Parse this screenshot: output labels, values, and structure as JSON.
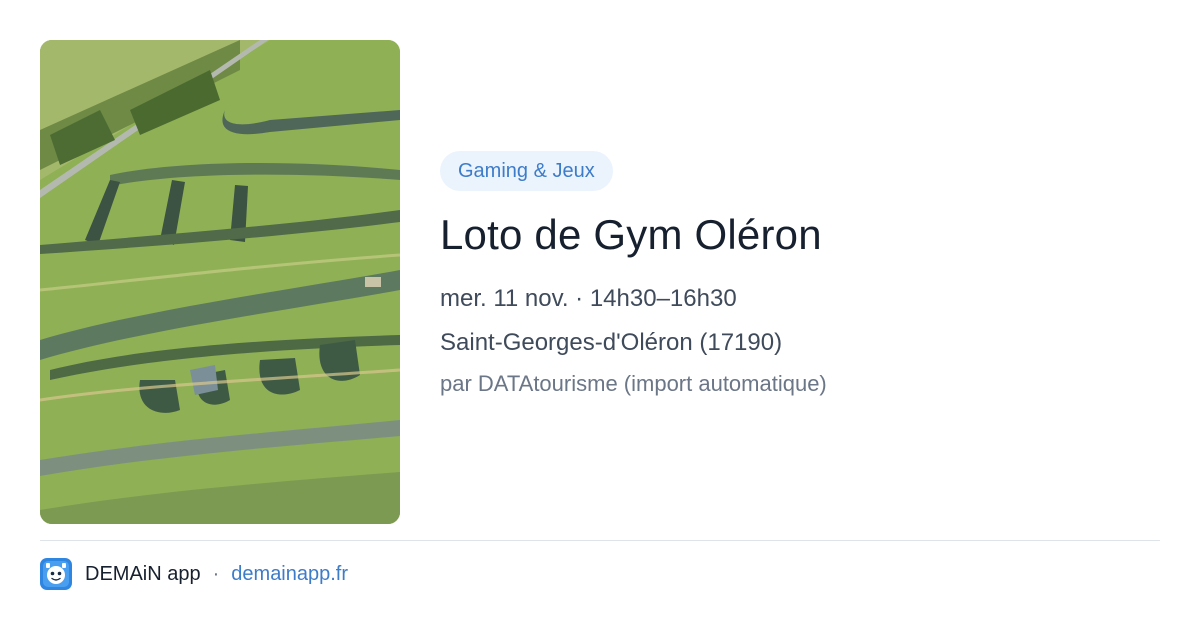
{
  "event": {
    "category": "Gaming & Jeux",
    "title": "Loto de Gym Oléron",
    "when": "mer. 11 nov. · 14h30–16h30",
    "where": "Saint-Georges-d'Oléron (17190)",
    "by": "par DATAtourisme (import automatique)"
  },
  "footer": {
    "app_name": "DEMAiN app",
    "separator": "·",
    "site": "demainapp.fr"
  },
  "colors": {
    "accent": "#3d7cc9",
    "tag_bg": "#ebf3fd",
    "title": "#17202e"
  },
  "icons": {
    "app_logo": "demain-app-logo-icon"
  }
}
